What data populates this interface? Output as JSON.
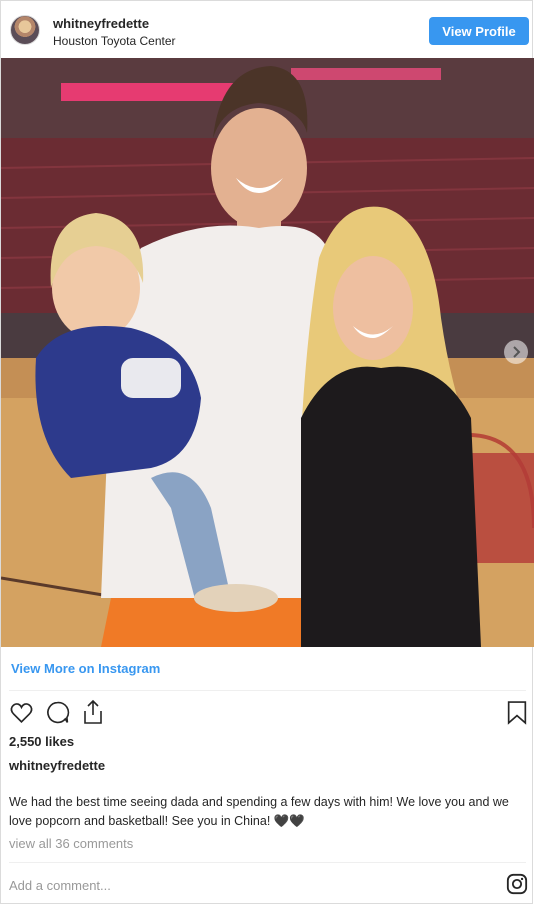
{
  "header": {
    "username": "whitneyfredette",
    "location": "Houston Toyota Center",
    "view_profile_label": "View Profile"
  },
  "post": {
    "image_alt": "Family photo on basketball court",
    "view_more_label": "View More on Instagram",
    "likes": "2,550 likes",
    "username": "whitneyfredette",
    "caption": "We had the best time seeing dada and spending a few days with him! We love you and we love popcorn and basketball! See you in China! 🖤🖤",
    "comments_label": "view all 36 comments",
    "add_comment_placeholder": "Add a comment..."
  },
  "colors": {
    "accent": "#3897f0",
    "text": "#262626",
    "muted": "#999999",
    "border": "#dbdbdb"
  },
  "icons": {
    "like": "heart-icon",
    "comment": "comment-icon",
    "share": "share-icon",
    "save": "bookmark-icon",
    "next": "chevron-right-icon",
    "instagram": "instagram-icon"
  }
}
